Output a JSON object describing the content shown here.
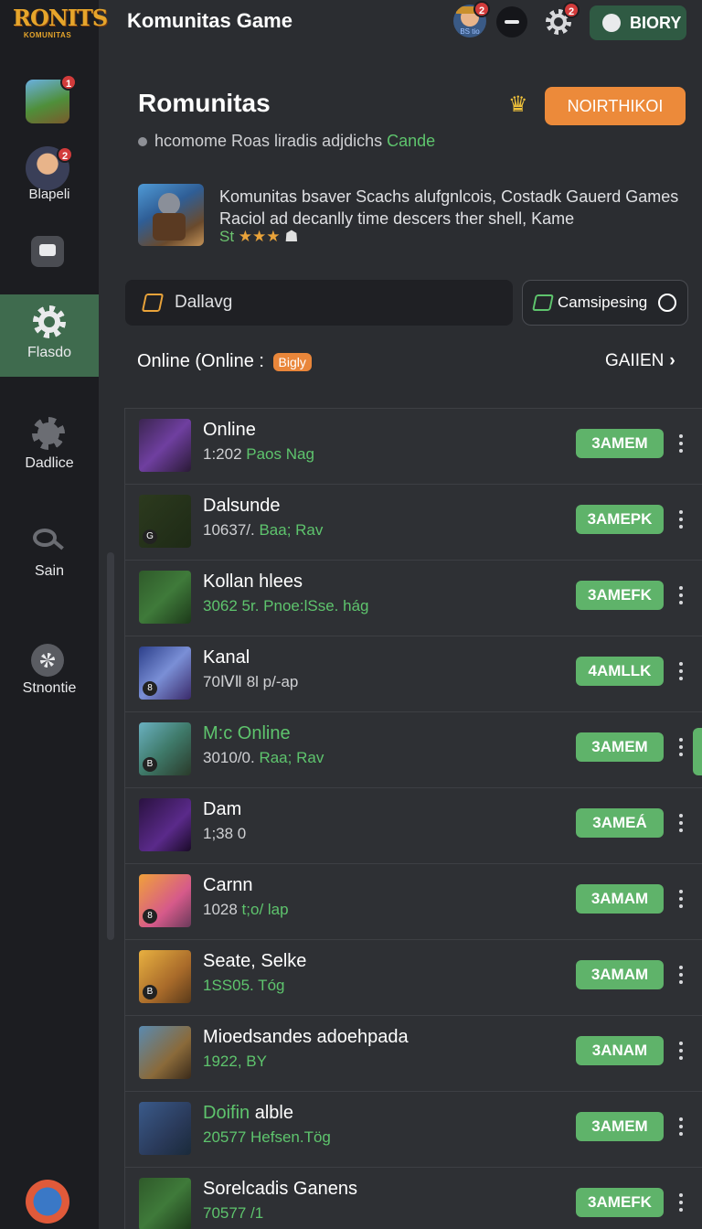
{
  "app": {
    "title": "Komunitas Game",
    "logo_main": "RONITS",
    "logo_sub": "KOMUNITAS"
  },
  "topbar": {
    "avatar_badge": "2",
    "avatar_caption": "BS tio",
    "gear_badge": "2",
    "action_label": "BIORY"
  },
  "sidebar": {
    "items": [
      {
        "label": "",
        "badge": "1"
      },
      {
        "label": "Blapeli",
        "badge": "2"
      },
      {
        "label": ""
      },
      {
        "label": "Flasdo"
      },
      {
        "label": "Dadlice"
      },
      {
        "label": "Sain"
      },
      {
        "label": "Stnontie"
      }
    ]
  },
  "community": {
    "title": "Romunitas",
    "subtitle": "hcomome Roas liradis adjdichs",
    "subtitle_highlight": "Cande",
    "primary_button": "NOIRTHIKOI",
    "about_text": "Komunitas bsaver Scachs alufgnlcois, Costadk Gauerd Games Raciol ad decanlly time descers ther shell, Kame",
    "rating_prefix": "St",
    "rating_stars": "★★★",
    "rating_tail": "☗",
    "filter_left": "Dallavg",
    "filter_right": "Camsipesing"
  },
  "section": {
    "title": "Online (Online :",
    "count": "Bigly",
    "link": "GAIIEN",
    "chevron": "›"
  },
  "games": [
    {
      "name": "Online",
      "meta_a": "1:202 ",
      "meta_b": "Paos Nag",
      "join": "3AMEM",
      "art": "purple",
      "tag": ""
    },
    {
      "name": "Dalsunde",
      "meta_a": "10637/. ",
      "meta_b": "Baa; Rav",
      "join": "3AMEPK",
      "art": "violet",
      "tag": "G"
    },
    {
      "name": "Kollan hlees",
      "meta_a": "",
      "meta_b": "3062 5r. Pnoe:lSse. hág",
      "join": "3AMEFK",
      "art": "green",
      "tag": ""
    },
    {
      "name": "Kanal",
      "meta_a": "70ⅣⅡ 8l p/-ap",
      "meta_b": "",
      "join": "4AMLLK",
      "art": "blue",
      "tag": "8"
    },
    {
      "name": "M:c Online",
      "meta_a": "3010/0. ",
      "meta_b": "Raa; Rav",
      "join": "3AMEM",
      "art": "teal",
      "tag": "B",
      "highlight": true
    },
    {
      "name": "Dam",
      "meta_a": "1;38 0",
      "meta_b": "",
      "join": "3AMEÁ",
      "art": "deep",
      "tag": ""
    },
    {
      "name": "Carnn",
      "meta_a": "1028 ",
      "meta_b": "t;o/ lap",
      "join": "3AMAM",
      "art": "orange",
      "tag": "8"
    },
    {
      "name": "Seate, Selke",
      "meta_a": "",
      "meta_b": "1SS05. Tóg",
      "join": "3AMAM",
      "art": "gold",
      "tag": "B"
    },
    {
      "name": "Mioedsandes adoehpada",
      "meta_a": "",
      "meta_b": "1922, BY",
      "join": "3ANAM",
      "art": "soldier",
      "tag": ""
    },
    {
      "name": "Doifin alble",
      "name_hl": "Doifin",
      "meta_a": "",
      "meta_b": "20577 Hefsen.Tög",
      "join": "3AMEM",
      "art": "sword",
      "tag": ""
    },
    {
      "name": "Sorelcadis Ganens",
      "meta_a": "",
      "meta_b": "70577 /1",
      "join": "3AMEFK",
      "art": "green",
      "tag": ""
    }
  ],
  "colors": {
    "accent_green": "#5fb36a",
    "accent_orange": "#ec8a3a",
    "badge_red": "#d23b3b",
    "sidebar_active": "#3f6b4e"
  },
  "icons": {
    "minus": "minus-icon",
    "settings": "gear-icon",
    "crown": "crown-icon",
    "chat": "chat-icon",
    "power": "power-icon",
    "more": "more-vertical-icon"
  }
}
